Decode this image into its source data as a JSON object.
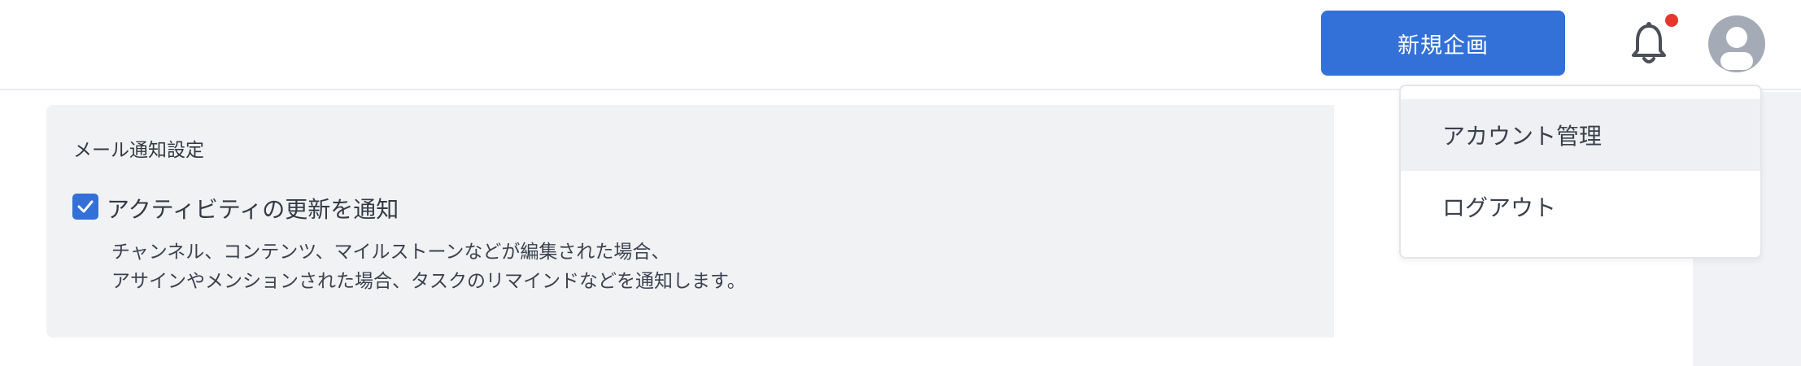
{
  "header": {
    "new_project_label": "新規企画",
    "notification_icon": "bell-icon",
    "has_unread_notification": true,
    "avatar_icon": "user-avatar-icon"
  },
  "notification_settings": {
    "section_title": "メール通知設定",
    "activity_checkbox": {
      "label": "アクティビティの更新を通知",
      "checked": true
    },
    "description_lines": [
      "チャンネル、コンテンツ、マイルストーンなどが編集された場合、",
      "アサインやメンションされた場合、タスクのリマインドなどを通知します。"
    ]
  },
  "user_menu": {
    "items": [
      {
        "label": "アカウント管理",
        "active": true
      },
      {
        "label": "ログアウト",
        "active": false
      }
    ]
  },
  "colors": {
    "primary": "#3370d8",
    "notification_dot": "#e5382d",
    "panel_background": "#f1f2f4",
    "avatar_background": "#a4abb6"
  }
}
